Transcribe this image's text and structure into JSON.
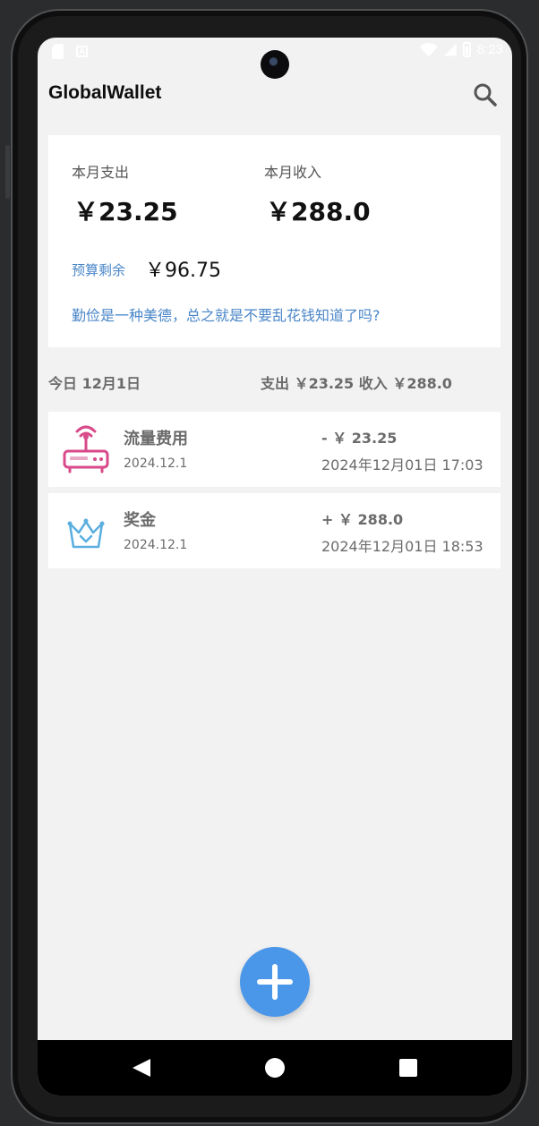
{
  "status_bar": {
    "time": "8:23",
    "left_icons": [
      "sim-card-icon",
      "text-a-icon"
    ],
    "right_icons": [
      "wifi-icon",
      "cellular-icon",
      "battery-icon"
    ]
  },
  "app_bar": {
    "title": "GlobalWallet",
    "search_icon": "search-icon"
  },
  "summary": {
    "expense_label": "本月支出",
    "expense_value": "￥23.25",
    "income_label": "本月收入",
    "income_value": "￥288.0",
    "budget_label": "预算剩余",
    "budget_value": "￥96.75",
    "motto": "勤俭是一种美德，总之就是不要乱花钱知道了吗?"
  },
  "day": {
    "label": "今日 12月1日",
    "totals": "支出 ￥23.25  收入 ￥288.0"
  },
  "records": [
    {
      "icon": "router-icon",
      "name": "流量费用",
      "date": "2024.12.1",
      "amount": "- ￥ 23.25",
      "time": "2024年12月01日 17:03"
    },
    {
      "icon": "crown-icon",
      "name": "奖金",
      "date": "2024.12.1",
      "amount": "+ ￥ 288.0",
      "time": "2024年12月01日 18:53"
    }
  ],
  "fab": {
    "icon": "plus-icon"
  },
  "nav_bar": {
    "icons": [
      "back-icon",
      "home-icon",
      "recents-icon"
    ]
  },
  "colors": {
    "accent": "#4a97e9",
    "link_blue": "#4a86c8",
    "background": "#f2f2f2",
    "card": "#ffffff",
    "router_icon": "#d84a8a",
    "crown_icon": "#5aaee0"
  }
}
